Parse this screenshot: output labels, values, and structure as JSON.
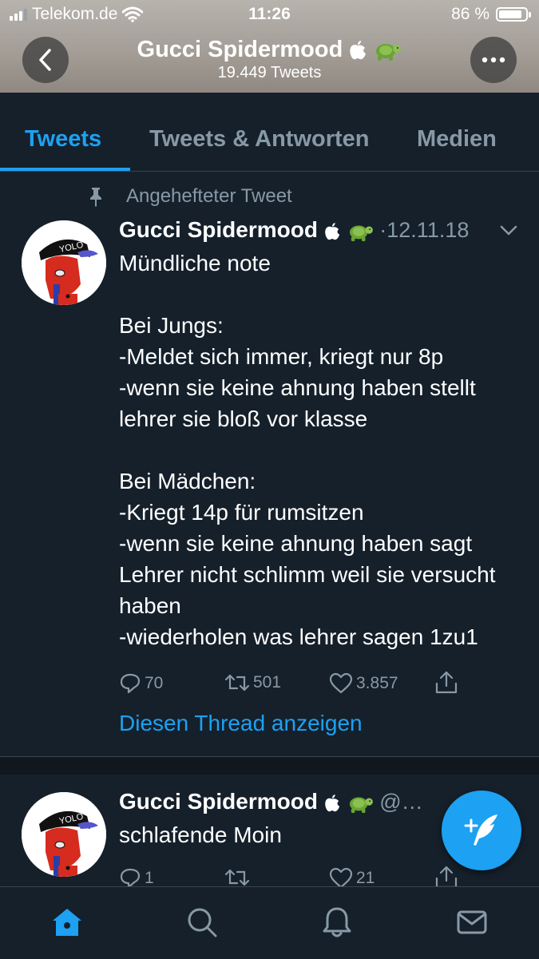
{
  "status_bar": {
    "carrier": "Telekom.de",
    "time": "11:26",
    "battery": "86 %",
    "battery_level": 0.86
  },
  "header": {
    "title": "Gucci Spidermood",
    "tweet_count": "19.449 Tweets"
  },
  "tabs": [
    {
      "label": "Tweets",
      "active": true
    },
    {
      "label": "Tweets & Antworten",
      "active": false
    },
    {
      "label": "Medien",
      "active": false
    }
  ],
  "pinned_label": "Angehefteter Tweet",
  "tweets": [
    {
      "author": "Gucci Spidermood",
      "meta": "·12.11.18",
      "avatar_cap_text": "YOLO",
      "text": "Mündliche note\n\nBei Jungs:\n-Meldet sich immer, kriegt nur 8p\n-wenn sie keine ahnung haben stellt lehrer sie bloß vor klasse\n\nBei Mädchen:\n-Kriegt 14p für rumsitzen\n-wenn sie keine ahnung haben sagt Lehrer nicht schlimm weil sie versucht haben\n-wiederholen was lehrer sagen 1zu1",
      "replies": "70",
      "retweets": "501",
      "likes": "3.857",
      "thread_link": "Diesen Thread anzeigen"
    },
    {
      "author": "Gucci Spidermood",
      "meta": "@…",
      "avatar_cap_text": "YOLO",
      "text": "schlafende Moin",
      "replies": "1",
      "retweets": "",
      "likes": "21"
    }
  ],
  "colors": {
    "background": "#15202b",
    "accent": "#1da1f2",
    "muted": "#8899a6",
    "divider": "#38444d"
  },
  "icons": [
    "back-icon",
    "more-icon",
    "pin-icon",
    "reply-icon",
    "retweet-icon",
    "like-icon",
    "share-icon",
    "compose-icon",
    "home-icon",
    "search-icon",
    "notifications-icon",
    "messages-icon"
  ]
}
